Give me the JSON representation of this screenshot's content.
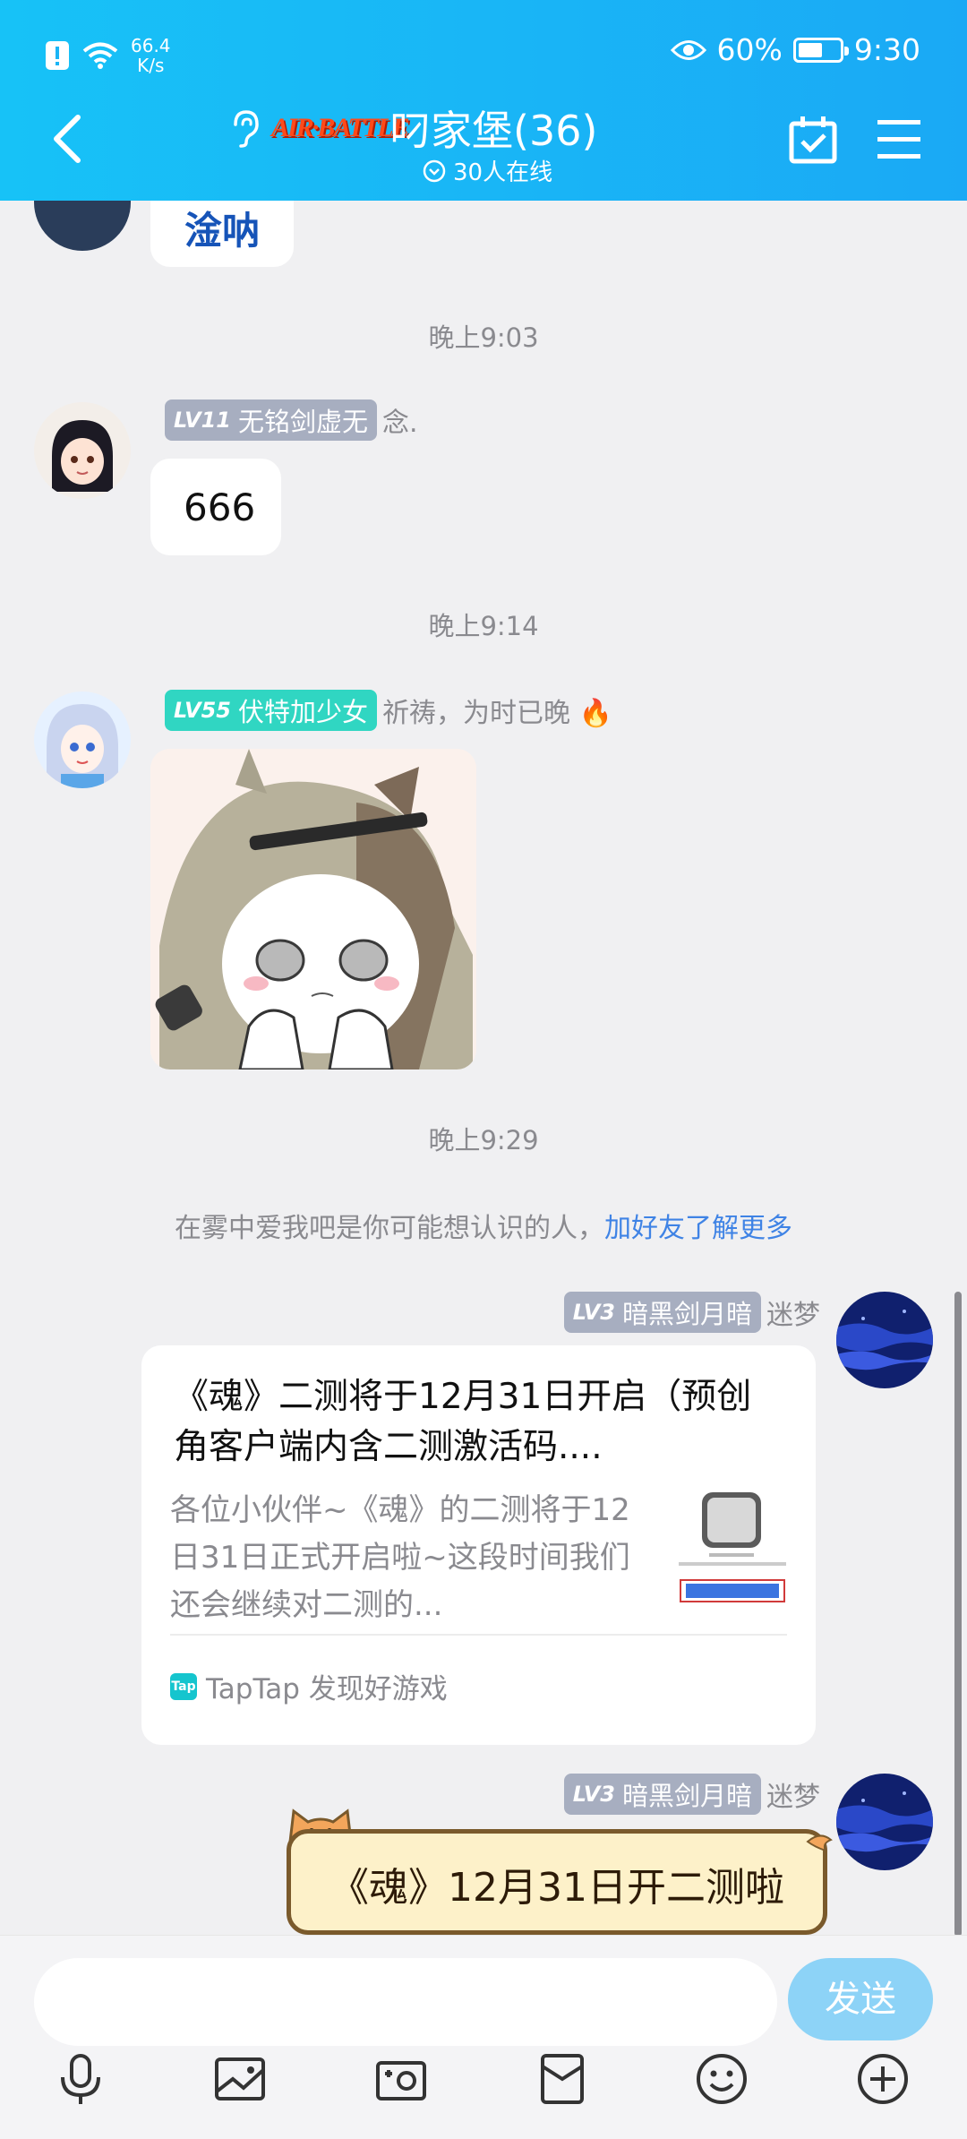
{
  "status": {
    "net_speed_value": "66.4",
    "net_speed_unit": "K/s",
    "battery": "60%",
    "battery_level": 0.6,
    "time": "9:30"
  },
  "header": {
    "title": "叼家堡(36)",
    "logo_text": "AIR·BATTLE",
    "online": "30人在线"
  },
  "messages": {
    "partial_text": "淦呐",
    "time1": "晚上9:03",
    "m1": {
      "level": "LV11",
      "title": "无铭剑虚无",
      "name": "念.",
      "text": "666"
    },
    "time2": "晚上9:14",
    "m2": {
      "level": "LV55",
      "title": "伏特加少女",
      "name": "祈祷，为时已晚 🔥"
    },
    "time3": "晚上9:29",
    "suggest_prefix": "在雾中爱我吧是你可能想认识的人，",
    "suggest_link": "加好友了解更多",
    "m3": {
      "level": "LV3",
      "title": "暗黑剑月暗",
      "name": "迷梦",
      "card_title": "《魂》二测将于12月31日开启（预创角客户端内含二测激活码....",
      "card_desc": "各位小伙伴~《魂》的二测将于12日31日正式开启啦~这段时间我们还会继续对二测的...",
      "card_source": "TapTap 发现好游戏",
      "tap_logo": "Tap"
    },
    "m4": {
      "level": "LV3",
      "title": "暗黑剑月暗",
      "name": "迷梦",
      "text": "《魂》12月31日开二测啦"
    }
  },
  "input": {
    "send": "发送"
  },
  "icons": [
    "microphone-icon",
    "image-icon",
    "camera-icon",
    "redpacket-icon",
    "emoji-icon",
    "plus-icon"
  ]
}
